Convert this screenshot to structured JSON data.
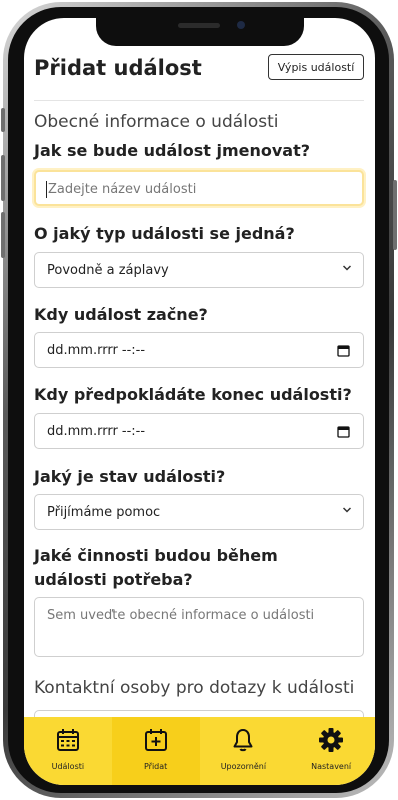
{
  "header": {
    "title": "Přidat událost",
    "list_button": "Výpis událostí"
  },
  "form": {
    "section_general": "Obecné informace o události",
    "name_label": "Jak se bude událost jmenovat?",
    "name_placeholder": "Zadejte název události",
    "type_label": "O jaký typ události se jedná?",
    "type_value": "Povodně a záplavy",
    "start_label": "Kdy událost začne?",
    "start_placeholder": "dd.mm.rrrr --:--",
    "end_label": "Kdy předpokládáte konec události?",
    "end_placeholder": "dd.mm.rrrr --:--",
    "status_label": "Jaký je stav události?",
    "status_value": "Přijímáme pomoc",
    "activities_label": "Jaké činnosti budou během události potřeba?",
    "activities_placeholder": "Sem uveďte obecné informace o události",
    "section_contacts": "Kontaktní osoby pro dotazy k události"
  },
  "nav": {
    "items": [
      {
        "label": "Události",
        "icon": "calendar-icon",
        "active": false
      },
      {
        "label": "Přidat",
        "icon": "calendar-plus-icon",
        "active": true
      },
      {
        "label": "Upozornění",
        "icon": "bell-icon",
        "active": false
      },
      {
        "label": "Nastavení",
        "icon": "gear-icon",
        "active": false
      }
    ]
  },
  "colors": {
    "nav_background": "#fad933",
    "nav_active": "#f7cf1b",
    "focus_border": "#fbe39a"
  }
}
